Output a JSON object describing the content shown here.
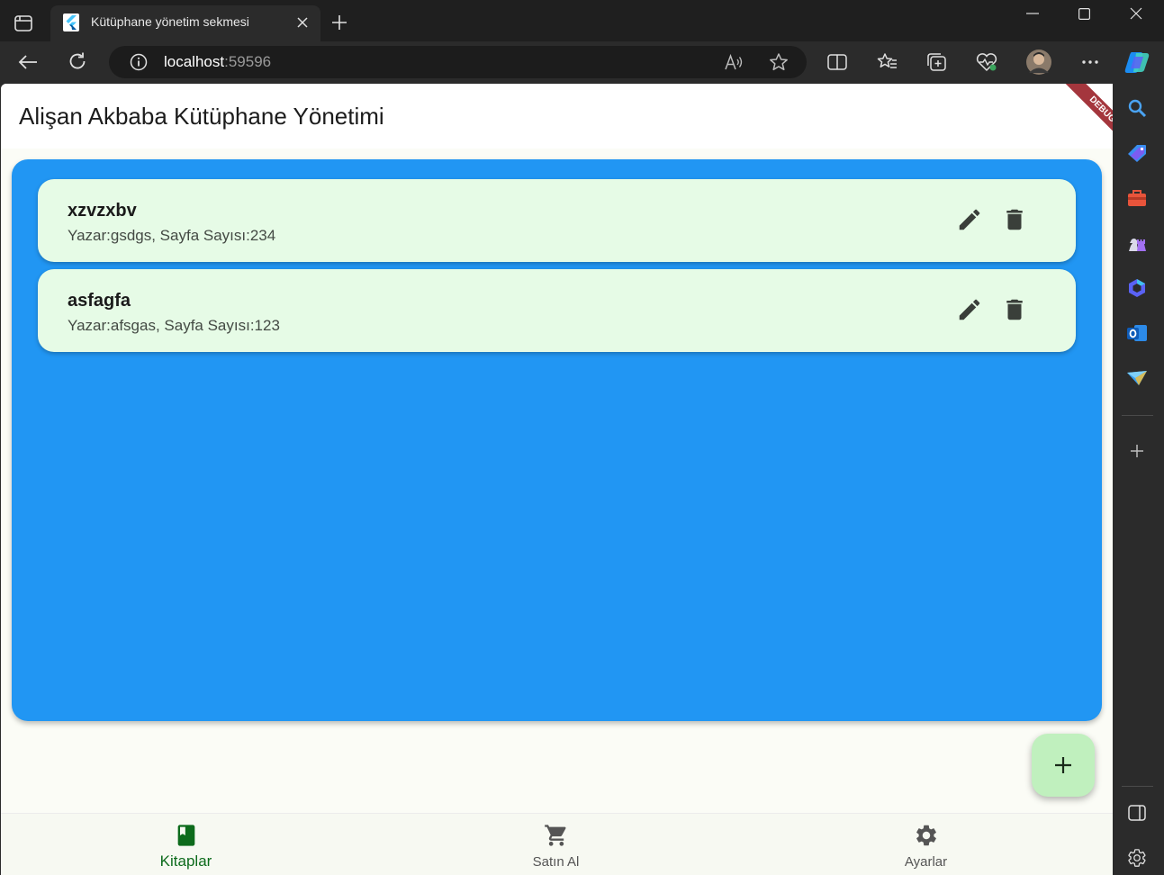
{
  "browser": {
    "tab_title": "Kütüphane yönetim sekmesi",
    "url_host": "localhost",
    "url_port": ":59596"
  },
  "app": {
    "title": "Alişan Akbaba Kütüphane Yönetimi",
    "debug_label": "DEBUG",
    "books": [
      {
        "title": "xzvzxbv",
        "subtitle": "Yazar:gsdgs, Sayfa Sayısı:234"
      },
      {
        "title": "asfagfa",
        "subtitle": "Yazar:afsgas, Sayfa Sayısı:123"
      }
    ],
    "nav": [
      {
        "label": "Kitaplar",
        "icon": "book-icon",
        "active": true
      },
      {
        "label": "Satın Al",
        "icon": "cart-icon",
        "active": false
      },
      {
        "label": "Ayarlar",
        "icon": "gear-icon",
        "active": false
      }
    ]
  },
  "colors": {
    "panel": "#2196f3",
    "card": "#e6fbe6",
    "fab": "#c0f0be",
    "nav_active": "#0d6b1c",
    "debug_ribbon": "#a4363d"
  }
}
